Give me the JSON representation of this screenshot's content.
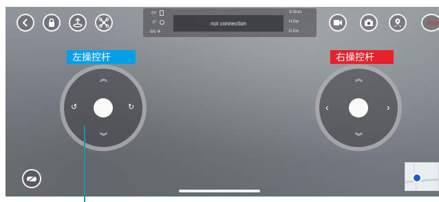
{
  "colors": {
    "left_label_bg": "#00a0e9",
    "right_label_bg": "#e62129",
    "stop_text": "#e62129",
    "pointer_line": "#1f93a9"
  },
  "top_bar": {
    "left_buttons": [
      "back-icon",
      "lock-icon",
      "takeoff-icon",
      "drone-icon"
    ],
    "right_buttons": [
      "video-record-icon",
      "camera-icon",
      "waypoint-icon"
    ],
    "stop_label": "Stop"
  },
  "telemetry": {
    "battery": "0V",
    "angle": "0°",
    "satellites": "0/5",
    "status": "not connection",
    "speed": "S:0m/s",
    "height": "H:0m",
    "distance": "D:0m"
  },
  "joysticks": {
    "left_label": "左操控杆",
    "right_label": "右操控杆"
  },
  "bottom": {
    "gamepad_icon": "gamepad-off-icon",
    "map_icon": "map-thumbnail-icon"
  }
}
